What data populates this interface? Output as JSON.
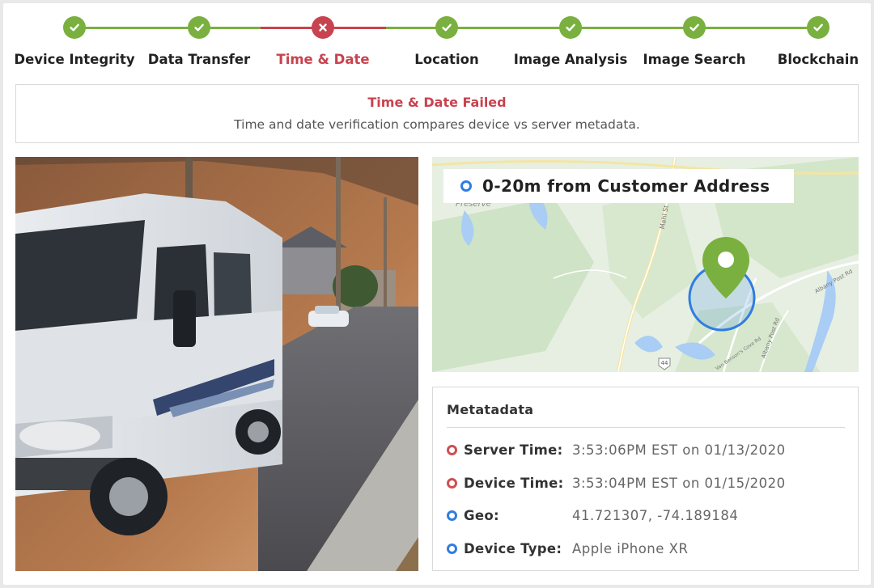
{
  "colors": {
    "success": "#7ab03f",
    "failure": "#c7434f",
    "accent_blue": "#2f7de1"
  },
  "steps": [
    {
      "label": "Device Integrity",
      "status": "passed",
      "icon": "check-icon"
    },
    {
      "label": "Data Transfer",
      "status": "passed",
      "icon": "check-icon"
    },
    {
      "label": "Time & Date",
      "status": "failed",
      "icon": "x-icon"
    },
    {
      "label": "Location",
      "status": "passed",
      "icon": "check-icon"
    },
    {
      "label": "Image Analysis",
      "status": "passed",
      "icon": "check-icon"
    },
    {
      "label": "Image Search",
      "status": "passed",
      "icon": "check-icon"
    },
    {
      "label": "Blockchain",
      "status": "passed",
      "icon": "check-icon"
    }
  ],
  "status": {
    "title": "Time & Date Failed",
    "description": "Time and date verification compares device vs server metadata."
  },
  "map": {
    "distance_label": "0-20m from Customer Address",
    "place_label": "Preserve",
    "road_labels": [
      "Mahl St",
      "Albany Post Rd",
      "Albany Post Rd",
      "Van Benson's Cove Rd"
    ],
    "route_number": "44",
    "pin_icon": "location-pin-icon"
  },
  "metadata": {
    "title": "Metatadata",
    "rows": [
      {
        "key": "Server Time:",
        "value": "3:53:06PM EST on 01/13/2020",
        "status": "error"
      },
      {
        "key": "Device Time:",
        "value": "3:53:04PM EST on 01/15/2020",
        "status": "error"
      },
      {
        "key": "Geo:",
        "value": "41.721307, -74.189184",
        "status": "ok"
      },
      {
        "key": "Device Type:",
        "value": "Apple iPhone XR",
        "status": "ok"
      }
    ]
  }
}
